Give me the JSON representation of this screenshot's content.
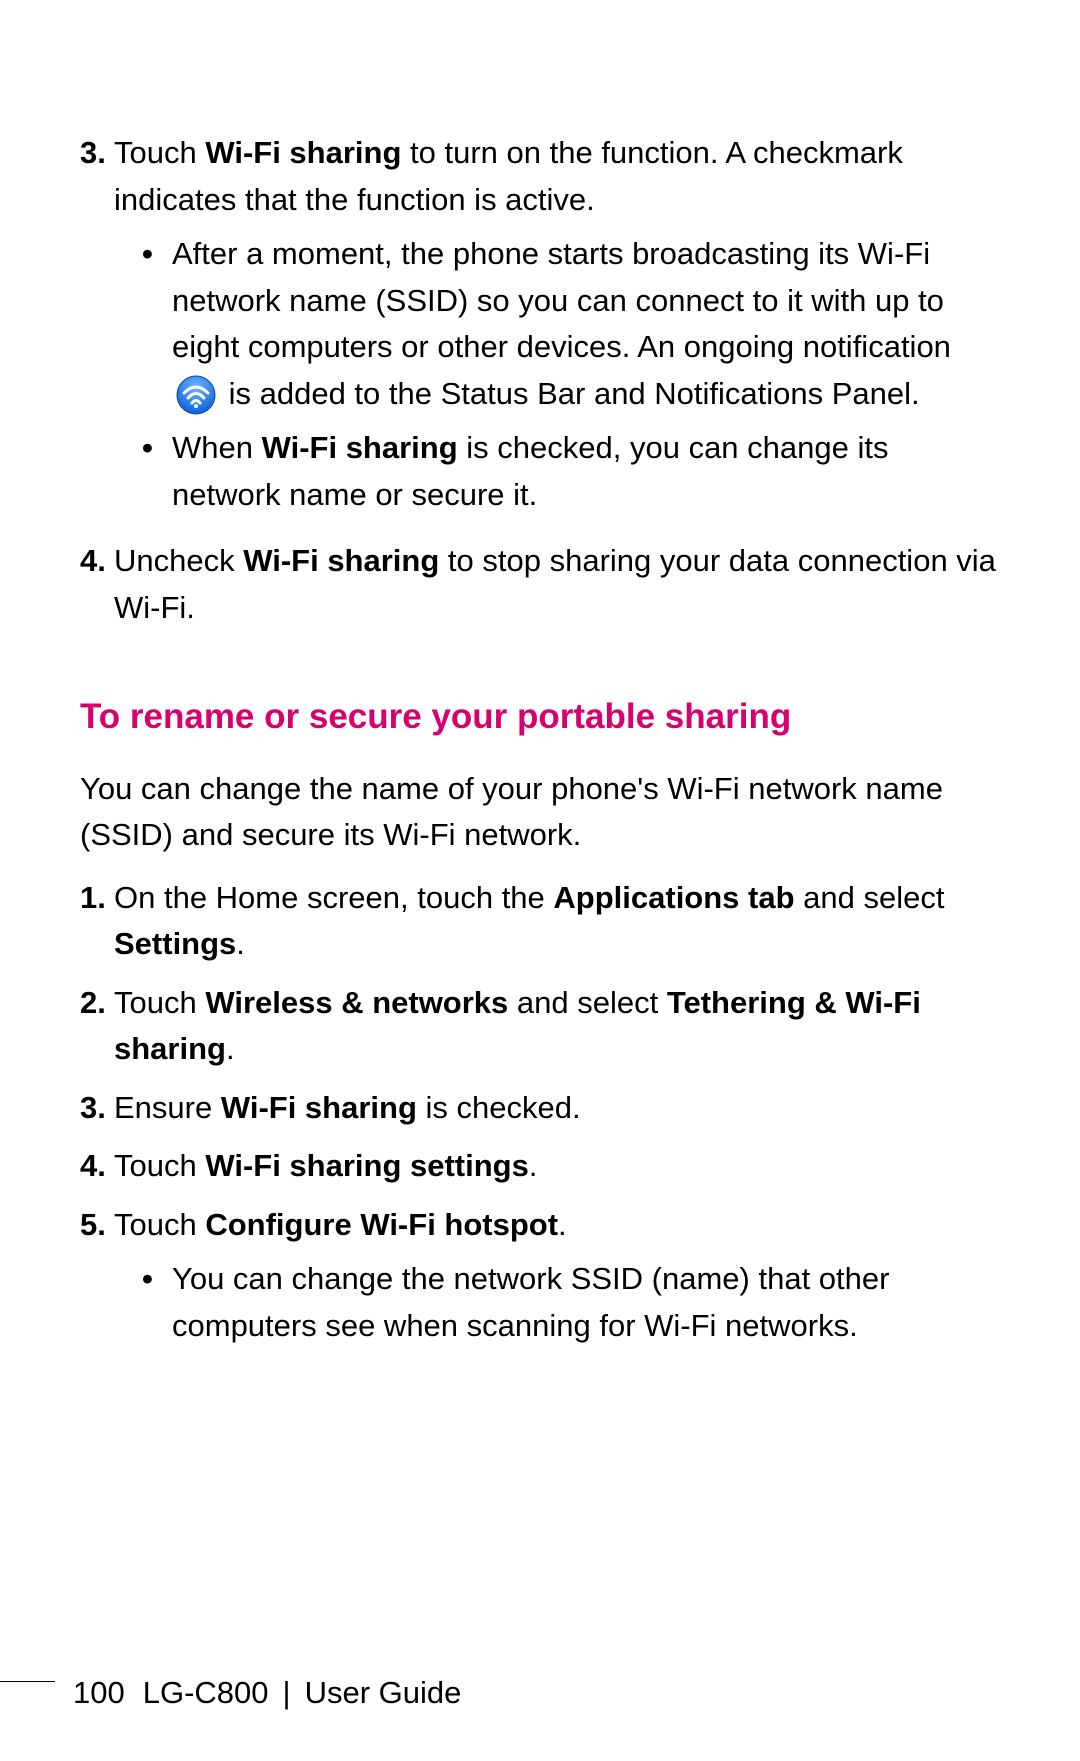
{
  "section1": {
    "items": [
      {
        "num": "3.",
        "parts": [
          {
            "t": "Touch "
          },
          {
            "t": "Wi-Fi sharing",
            "bold": true
          },
          {
            "t": " to turn on the function. A checkmark indicates that the function is active."
          }
        ],
        "sub": [
          {
            "parts": [
              {
                "t": "After a moment, the phone starts broadcasting its Wi-Fi network name (SSID) so you can connect to it with up to eight computers or other devices. An ongoing notification "
              },
              {
                "icon": "wifi-icon"
              },
              {
                "t": " is added to the Status Bar and Notifications Panel."
              }
            ]
          },
          {
            "parts": [
              {
                "t": "When "
              },
              {
                "t": "Wi-Fi sharing",
                "bold": true
              },
              {
                "t": " is checked, you can change its network name or secure it."
              }
            ]
          }
        ]
      },
      {
        "num": "4.",
        "parts": [
          {
            "t": "Uncheck "
          },
          {
            "t": "Wi-Fi sharing",
            "bold": true
          },
          {
            "t": " to stop sharing your data connection via Wi-Fi."
          }
        ]
      }
    ]
  },
  "heading": "To rename or secure your portable sharing",
  "intro": "You can change the name of your phone's Wi-Fi network name (SSID) and secure its Wi-Fi network.",
  "section2": {
    "items": [
      {
        "num": "1.",
        "parts": [
          {
            "t": "On the Home screen, touch the "
          },
          {
            "t": "Applications tab",
            "bold": true
          },
          {
            "t": " and select "
          },
          {
            "t": "Settings",
            "bold": true
          },
          {
            "t": "."
          }
        ]
      },
      {
        "num": "2.",
        "parts": [
          {
            "t": "Touch "
          },
          {
            "t": "Wireless & networks",
            "bold": true
          },
          {
            "t": " and select "
          },
          {
            "t": "Tethering & Wi-Fi sharing",
            "bold": true
          },
          {
            "t": "."
          }
        ]
      },
      {
        "num": "3.",
        "parts": [
          {
            "t": "Ensure "
          },
          {
            "t": "Wi-Fi sharing",
            "bold": true
          },
          {
            "t": " is checked."
          }
        ]
      },
      {
        "num": "4.",
        "parts": [
          {
            "t": "Touch "
          },
          {
            "t": "Wi-Fi sharing settings",
            "bold": true
          },
          {
            "t": "."
          }
        ]
      },
      {
        "num": "5.",
        "parts": [
          {
            "t": "Touch "
          },
          {
            "t": "Configure Wi-Fi hotspot",
            "bold": true
          },
          {
            "t": "."
          }
        ],
        "sub": [
          {
            "parts": [
              {
                "t": "You can change the network SSID (name) that other computers see when scanning for Wi-Fi networks."
              }
            ]
          }
        ]
      }
    ]
  },
  "footer": {
    "page": "100",
    "model": "LG-C800",
    "sep": "|",
    "guide": "User Guide"
  },
  "bullet": "•"
}
